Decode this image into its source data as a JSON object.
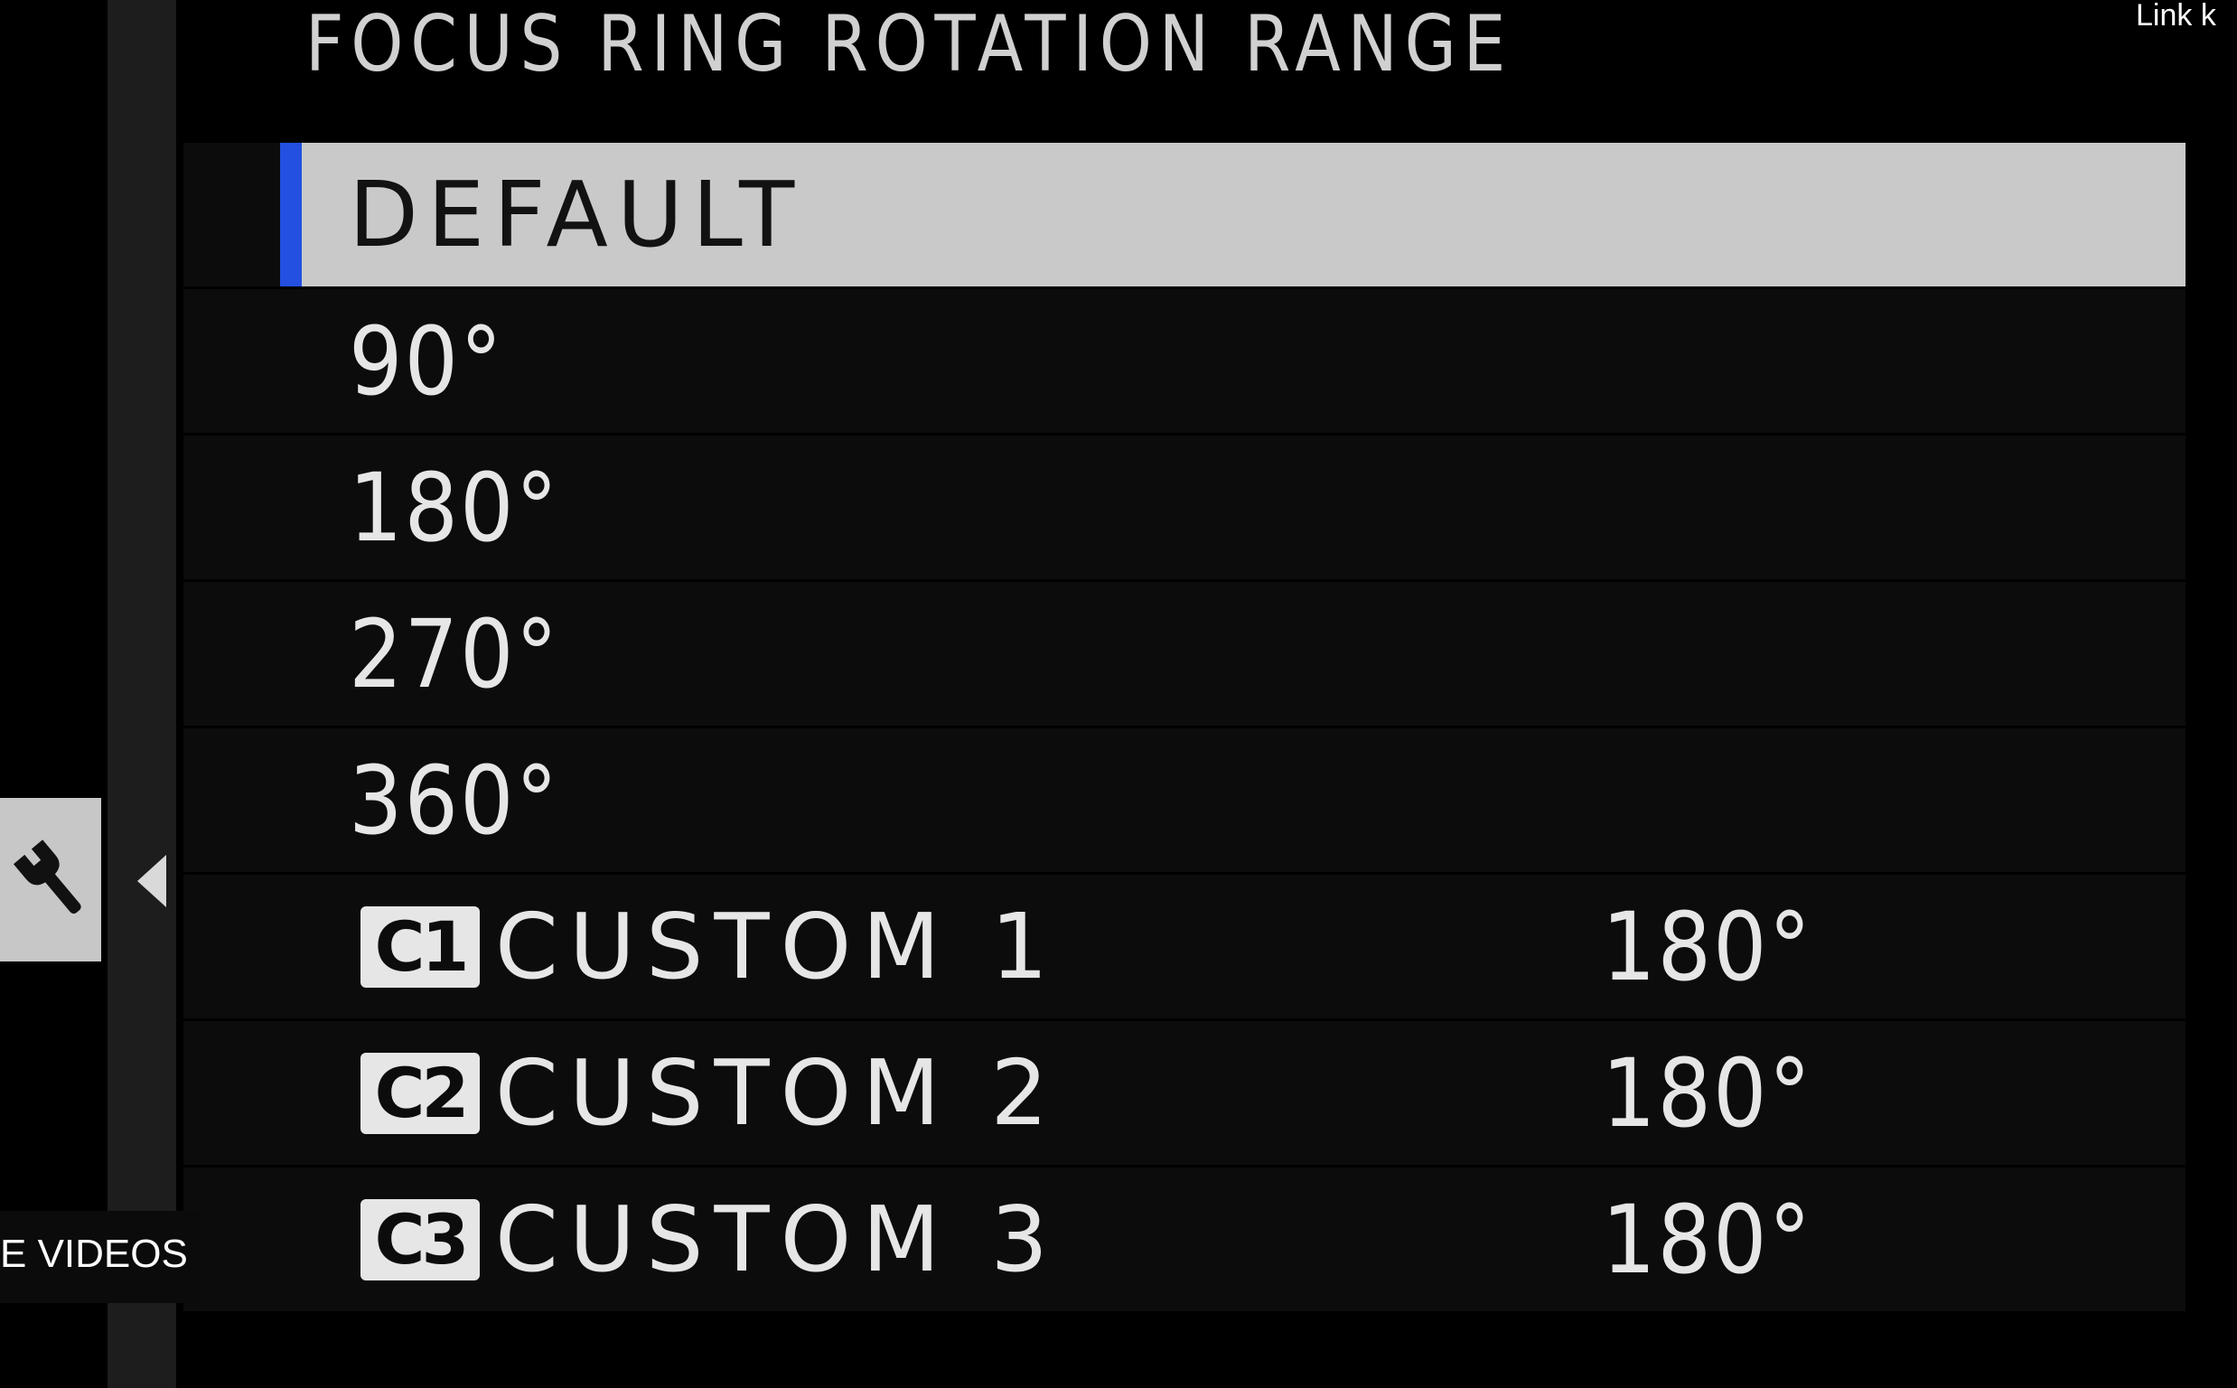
{
  "menu": {
    "title": "FOCUS RING ROTATION RANGE",
    "options": [
      {
        "label": "DEFAULT",
        "selected": true
      },
      {
        "label": "90°"
      },
      {
        "label": "180°"
      },
      {
        "label": "270°"
      },
      {
        "label": "360°"
      }
    ],
    "customs": [
      {
        "badge": "C1",
        "label": "CUSTOM 1",
        "value": "180°"
      },
      {
        "badge": "C2",
        "label": "CUSTOM 2",
        "value": "180°"
      },
      {
        "badge": "C3",
        "label": "CUSTOM 3",
        "value": "180°"
      }
    ]
  },
  "side_tab": {
    "icon": "wrench-icon"
  },
  "back": {
    "icon": "left-arrow-icon"
  },
  "overlay": {
    "link_text": "Link k",
    "videos_text": "E VIDEOS"
  },
  "colors": {
    "selection_accent": "#2350e0",
    "selected_row_bg": "#c9c9c9",
    "row_bg": "#0c0c0c",
    "background": "#000000"
  }
}
